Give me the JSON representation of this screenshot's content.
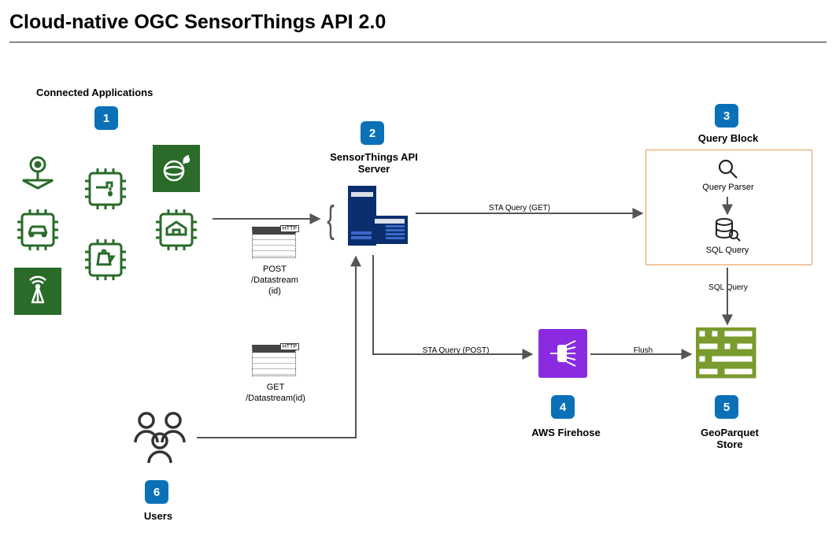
{
  "title": "Cloud-native OGC SensorThings API 2.0",
  "sections": {
    "connected_apps": {
      "label": "Connected Applications",
      "badge": "1"
    },
    "sta_server": {
      "label": "SensorThings API\nServer",
      "badge": "2"
    },
    "query_block": {
      "label": "Query Block",
      "badge": "3",
      "parser_label": "Query Parser",
      "sql_label": "SQL Query"
    },
    "firehose": {
      "label": "AWS Firehose",
      "badge": "4"
    },
    "geoparquet": {
      "label": "GeoParquet\nStore",
      "badge": "5"
    },
    "users": {
      "label": "Users",
      "badge": "6"
    }
  },
  "http": {
    "post": {
      "tag": "HTTP",
      "caption": "POST\n/Datastream\n(id)"
    },
    "get": {
      "tag": "HTTP",
      "caption": "GET\n/Datastream(id)"
    }
  },
  "edges": {
    "sta_get": "STA Query (GET)",
    "sta_post": "STA Query (POST)",
    "flush": "Flush",
    "sql_query": "SQL Query"
  },
  "icon_names": {
    "map_pin": "map-pin-icon",
    "car_chip": "car-chip-icon",
    "faucet_chip": "faucet-chip-icon",
    "kettle_chip": "kettle-chip-icon",
    "antenna": "antenna-icon",
    "globe": "globe-icon",
    "house_chip": "house-chip-icon",
    "server": "server-icon",
    "magnifier": "magnifier-icon",
    "db_query": "db-query-icon",
    "firehose": "firehose-icon",
    "grid": "geoparquet-grid-icon",
    "users": "users-icon"
  }
}
